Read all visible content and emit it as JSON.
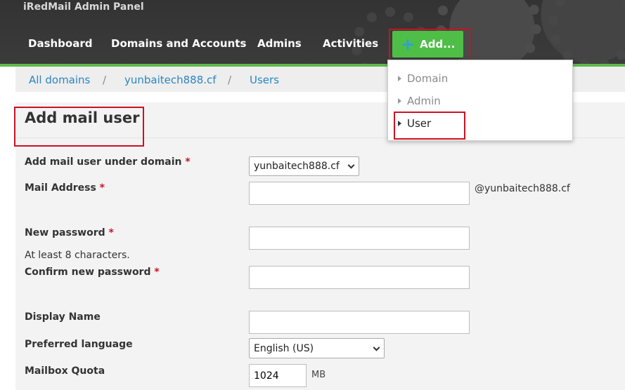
{
  "app": {
    "title": "iRedMail Admin Panel"
  },
  "nav": {
    "dashboard": "Dashboard",
    "domains": "Domains and Accounts",
    "admins": "Admins",
    "activities": "Activities",
    "add": "Add..."
  },
  "add_menu": {
    "items": [
      {
        "label": "Domain"
      },
      {
        "label": "Admin"
      },
      {
        "label": "User"
      }
    ]
  },
  "breadcrumb": {
    "all_domains": "All domains",
    "domain": "yunbaitech888.cf",
    "users": "Users",
    "separator": "/"
  },
  "page": {
    "title": "Add mail user"
  },
  "form": {
    "domain_label": "Add mail user under domain",
    "domain_value": "yunbaitech888.cf",
    "mail_label": "Mail Address",
    "mail_suffix": "@yunbaitech888.cf",
    "password_label": "New password",
    "password_hint": "At least 8 characters.",
    "confirm_label": "Confirm new password",
    "display_label": "Display Name",
    "language_label": "Preferred language",
    "language_value": "English (US)",
    "quota_label": "Mailbox Quota",
    "quota_value": "1024",
    "quota_unit": "MB",
    "required_mark": "*"
  },
  "colors": {
    "header_bg": "#3a3a3a",
    "accent_green": "#4fbe47",
    "link_blue": "#2a85c1",
    "highlight_red": "#cc1122"
  }
}
